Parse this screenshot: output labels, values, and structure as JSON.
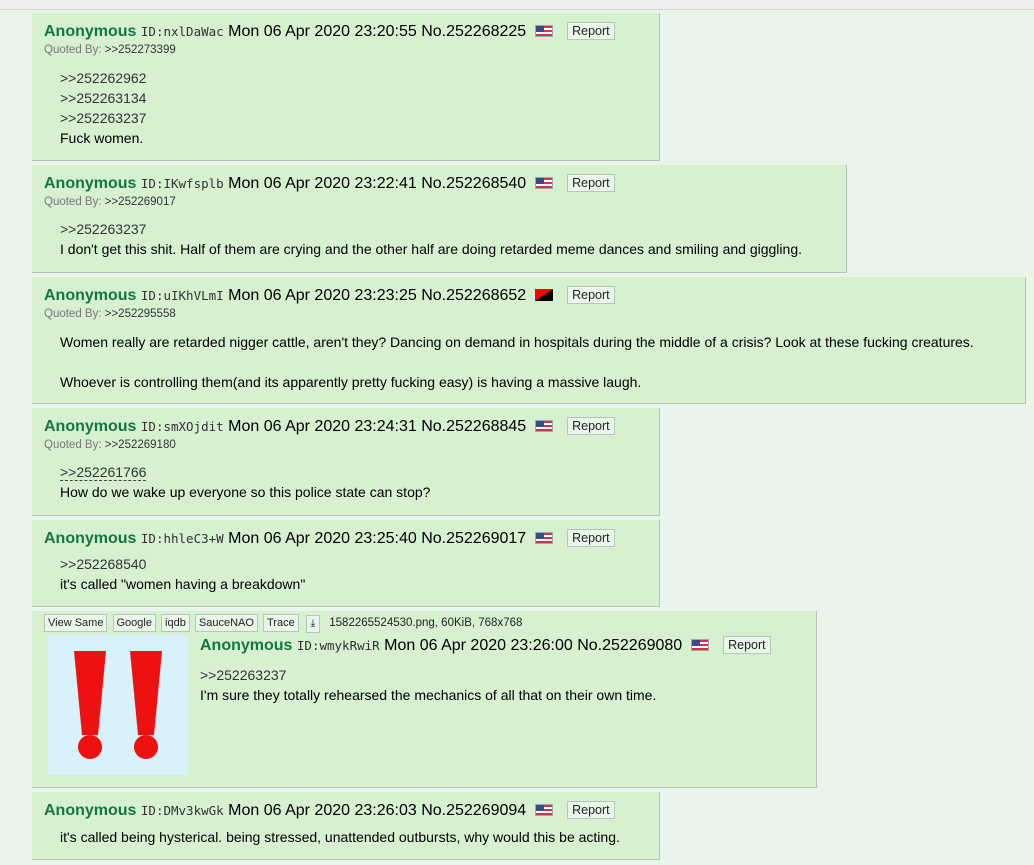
{
  "report_label": "Report",
  "quoted_by_label": "Quoted By:",
  "posts": [
    {
      "name": "Anonymous",
      "id": "ID:nxlDaWac",
      "date": "Mon 06 Apr 2020 23:20:55",
      "no": "No.252268225",
      "flag": "US",
      "quoted_by": ">>252273399",
      "lines": [
        ">>252262962",
        ">>252263134",
        ">>252263237",
        "Fuck women."
      ]
    },
    {
      "name": "Anonymous",
      "id": "ID:IKwfsplb",
      "date": "Mon 06 Apr 2020 23:22:41",
      "no": "No.252268540",
      "flag": "US",
      "quoted_by": ">>252269017",
      "lines": [
        ">>252263237",
        "I don't get this shit. Half of them are crying and the other half are doing retarded meme dances and smiling and giggling."
      ]
    },
    {
      "name": "Anonymous",
      "id": "ID:uIKhVLmI",
      "date": "Mon 06 Apr 2020 23:23:25",
      "no": "No.252268652",
      "flag": "Anarcho-Capitalist",
      "quoted_by": ">>252295558",
      "lines": [
        "Women really are retarded nigger cattle, aren't they? Dancing on demand in hospitals during the middle of a crisis? Look at these fucking creatures.",
        "",
        "Whoever is controlling them(and its apparently pretty fucking easy) is having a massive laugh."
      ]
    },
    {
      "name": "Anonymous",
      "id": "ID:smXOjdit",
      "date": "Mon 06 Apr 2020 23:24:31",
      "no": "No.252268845",
      "flag": "US",
      "quoted_by": ">>252269180",
      "lines": [
        ">>252261766",
        "How do we wake up everyone so this police state can stop?"
      ]
    },
    {
      "name": "Anonymous",
      "id": "ID:hhleC3+W",
      "date": "Mon 06 Apr 2020 23:25:40",
      "no": "No.252269017",
      "flag": "US",
      "lines": [
        ">>252268540",
        "it's called \"women having a breakdown\""
      ]
    },
    {
      "name": "Anonymous",
      "id": "ID:wmykRwiR",
      "date": "Mon 06 Apr 2020 23:26:00",
      "no": "No.252269080",
      "flag": "US",
      "lines": [
        ">>252263237",
        "I'm sure they totally rehearsed the mechanics of all that on their own time."
      ],
      "file": {
        "buttons": [
          "View Same",
          "Google",
          "iqdb",
          "SauceNAO",
          "Trace"
        ],
        "filename": "1582265524530.png, 60KiB, 768x768",
        "thumb_color": "#d8f1fa",
        "mark_color": "#ee1111"
      }
    },
    {
      "name": "Anonymous",
      "id": "ID:DMv3kwGk",
      "date": "Mon 06 Apr 2020 23:26:03",
      "no": "No.252269094",
      "flag": "US",
      "lines": [
        "it's called being hysterical. being stressed, unattended outbursts, why would this be acting."
      ]
    }
  ]
}
